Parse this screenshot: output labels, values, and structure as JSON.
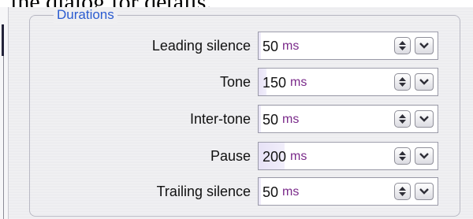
{
  "caption_fragment": "the dialog for details.",
  "group_title": "Durations",
  "unit": "ms",
  "rows": [
    {
      "label": "Leading silence",
      "value": "50",
      "level": 0.02
    },
    {
      "label": "Tone",
      "value": "150",
      "level": 0.06
    },
    {
      "label": "Inter-tone",
      "value": "50",
      "level": 0.02
    },
    {
      "label": "Pause",
      "value": "200",
      "level": 0.2
    },
    {
      "label": "Trailing silence",
      "value": "50",
      "level": 0.02
    }
  ],
  "icons": {
    "spin": "up-down-spinner-icon",
    "drop": "chevron-down-icon"
  },
  "colors": {
    "group_title": "#2a5bd0",
    "unit": "#7a2a8a"
  }
}
